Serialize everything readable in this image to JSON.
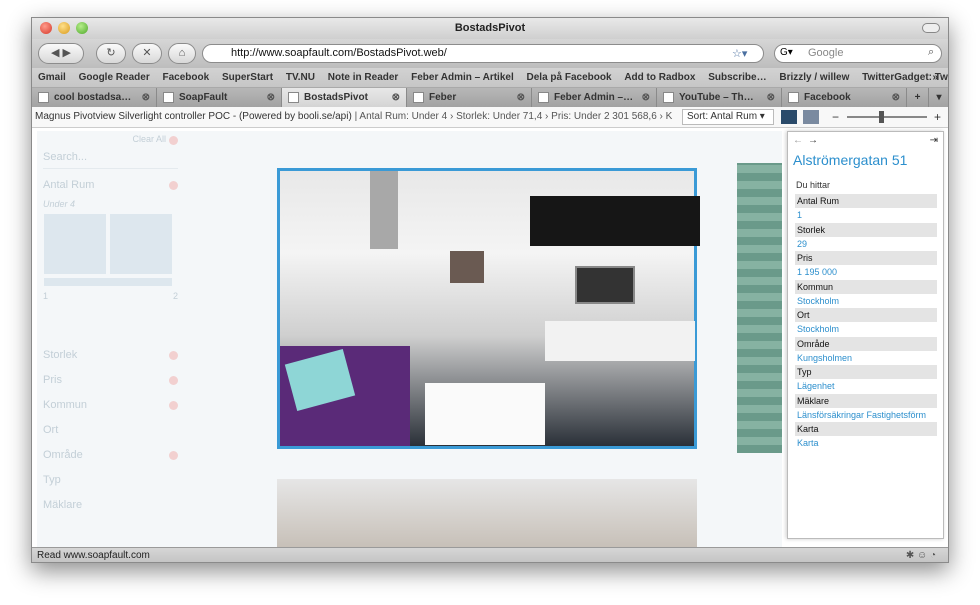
{
  "window": {
    "title": "BostadsPivot"
  },
  "navigation": {
    "url": "http://www.soapfault.com/BostadsPivot.web/",
    "search_placeholder": "Google"
  },
  "bookmarks": [
    "Gmail",
    "Google Reader",
    "Facebook",
    "SuperStart",
    "TV.NU",
    "Note in Reader",
    "Feber Admin – Artikel",
    "Dela på Facebook",
    "Add to Radbox",
    "Subscribe…",
    "Brizzly / willew",
    "TwitterGadget: Twitt…"
  ],
  "tabs": [
    {
      "label": "cool bostadsa…"
    },
    {
      "label": "SoapFault"
    },
    {
      "label": "BostadsPivot"
    },
    {
      "label": "Feber"
    },
    {
      "label": "Feber Admin –…"
    },
    {
      "label": "YouTube – Th…"
    },
    {
      "label": "Facebook"
    }
  ],
  "controller": {
    "title": "Magnus Pivotview Silverlight controller POC - (Powered by booli.se/api)",
    "breadcrumb": "Antal Rum: Under 4 › Storlek: Under 71,4 › Pris: Under 2 301 568,6 › K",
    "sort": "Sort: Antal Rum ▾"
  },
  "filters": {
    "clear_all": "Clear All",
    "search_placeholder": "Search...",
    "antal_rum": "Antal Rum",
    "antal_rum_value": "Under 4",
    "histogram_min": "1",
    "histogram_max": "2",
    "categories": [
      "Storlek",
      "Pris",
      "Kommun",
      "Ort",
      "Område",
      "Typ",
      "Mäklare"
    ]
  },
  "detail": {
    "title": "Alströmergatan 51",
    "intro": "Du hittar",
    "properties": [
      {
        "key": "Antal Rum",
        "value": "1"
      },
      {
        "key": "Storlek",
        "value": "29"
      },
      {
        "key": "Pris",
        "value": "1 195 000"
      },
      {
        "key": "Kommun",
        "value": "Stockholm"
      },
      {
        "key": "Ort",
        "value": "Stockholm"
      },
      {
        "key": "Område",
        "value": "Kungsholmen"
      },
      {
        "key": "Typ",
        "value": "Lägenhet"
      },
      {
        "key": "Mäklare",
        "value": "Länsförsäkringar Fastighetsförm"
      },
      {
        "key": "Karta",
        "value": "Karta"
      }
    ]
  },
  "status": {
    "text": "Read www.soapfault.com"
  }
}
